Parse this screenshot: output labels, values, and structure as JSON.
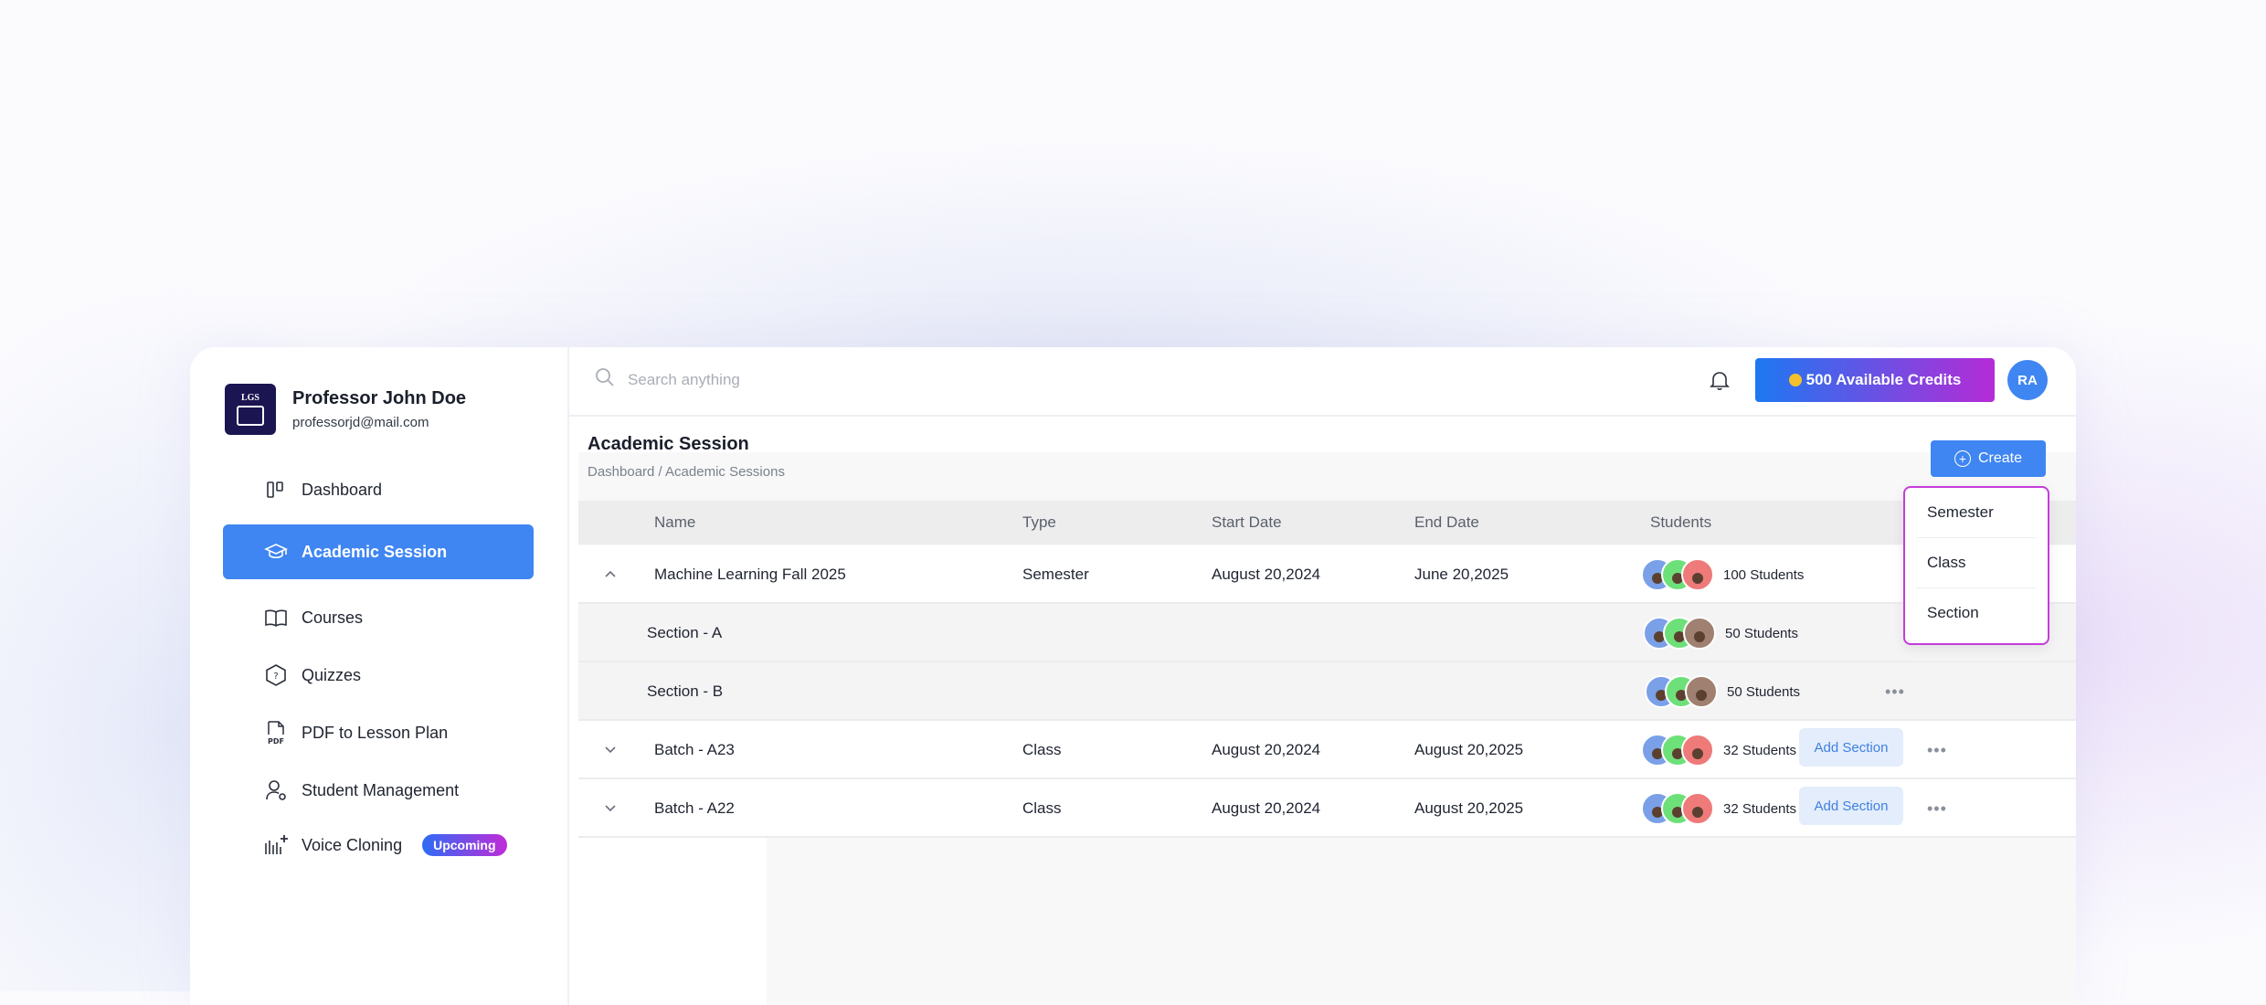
{
  "profile": {
    "name": "Professor John Doe",
    "email": "professorjd@mail.com",
    "logo_text": "LGS"
  },
  "sidebar": {
    "items": [
      {
        "label": "Dashboard",
        "icon": "dashboard-icon"
      },
      {
        "label": "Academic Session",
        "icon": "graduation-cap-icon",
        "active": true
      },
      {
        "label": "Courses",
        "icon": "book-icon"
      },
      {
        "label": "Quizzes",
        "icon": "quiz-icon"
      },
      {
        "label": "PDF to Lesson Plan",
        "icon": "pdf-icon"
      },
      {
        "label": "Student Management",
        "icon": "student-icon"
      },
      {
        "label": "Voice Cloning",
        "icon": "voice-icon",
        "badge": "Upcoming"
      }
    ]
  },
  "topbar": {
    "search_placeholder": "Search anything",
    "credits_label": "500 Available Credits",
    "avatar_initials": "RA"
  },
  "page": {
    "title": "Academic Session",
    "breadcrumb": "Dashboard / Academic Sessions",
    "create_label": "Create"
  },
  "table": {
    "columns": [
      "Name",
      "Type",
      "Start Date",
      "End Date",
      "Students"
    ],
    "rows": [
      {
        "name": "Machine Learning Fall 2025",
        "type": "Semester",
        "start": "August 20,2024",
        "end": "June 20,2025",
        "students": "100 Students",
        "expanded": true
      },
      {
        "name": "Section - A",
        "students": "50 Students",
        "sub": true
      },
      {
        "name": "Section - B",
        "students": "50 Students",
        "sub": true
      },
      {
        "name": "Batch - A23",
        "type": "Class",
        "start": "August 20,2024",
        "end": "August 20,2025",
        "students": "32 Students",
        "action": "Add Section"
      },
      {
        "name": "Batch - A22",
        "type": "Class",
        "start": "August 20,2024",
        "end": "August 20,2025",
        "students": "32 Students",
        "action": "Add Section"
      }
    ]
  },
  "dropdown": {
    "options": [
      "Semester",
      "Class",
      "Section"
    ]
  },
  "colors": {
    "accent": "#3f86f2",
    "gradient_start": "#1d78f2",
    "gradient_end": "#b52bd6",
    "dropdown_border": "#c43dd9"
  }
}
